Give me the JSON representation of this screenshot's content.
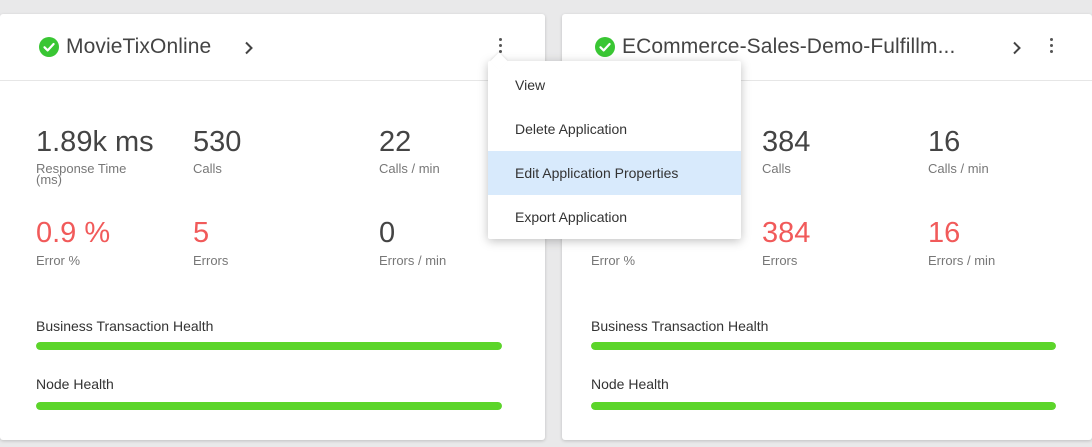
{
  "colors": {
    "ok_green": "#39c633",
    "health_green": "#5cd52a",
    "error_red": "#f15a5a",
    "menu_highlight": "#d8eafc"
  },
  "cards": [
    {
      "title": "MovieTixOnline",
      "status_icon": "check-circle-icon",
      "metrics_row1": [
        {
          "value": "1.89k ms",
          "label": "Response Time\n(ms)"
        },
        {
          "value": "530",
          "label": "Calls"
        },
        {
          "value": "22",
          "label": "Calls / min"
        }
      ],
      "metrics_row2": [
        {
          "value": "0.9 %",
          "label": "Error %"
        },
        {
          "value": "5",
          "label": "Errors"
        },
        {
          "value": "0",
          "label": "Errors / min"
        }
      ],
      "health": [
        {
          "label": "Business Transaction Health",
          "level": 1.0
        },
        {
          "label": "Node Health",
          "level": 1.0
        }
      ]
    },
    {
      "title": "ECommerce-Sales-Demo-Fulfillm...",
      "status_icon": "check-circle-icon",
      "metrics_row1": [
        {
          "value": "384",
          "label": "Calls"
        },
        {
          "value": "16",
          "label": "Calls / min"
        }
      ],
      "metrics_row2": [
        {
          "value": "384",
          "label": "Errors"
        },
        {
          "value": "16",
          "label": "Errors / min"
        },
        {
          "label": "Error %"
        }
      ],
      "health": [
        {
          "label": "Business Transaction Health",
          "level": 1.0
        },
        {
          "label": "Node Health",
          "level": 1.0
        }
      ]
    }
  ],
  "context_menu": {
    "items": [
      {
        "label": "View"
      },
      {
        "label": "Delete Application"
      },
      {
        "label": "Edit Application Properties",
        "highlighted": true
      },
      {
        "label": "Export Application"
      }
    ]
  }
}
